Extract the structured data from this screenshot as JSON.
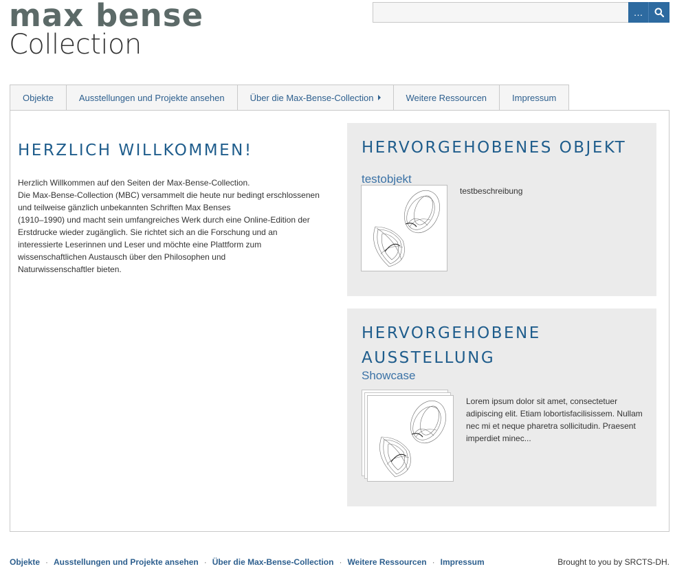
{
  "header": {
    "logo_line1": "max bense",
    "logo_line2": "Collection",
    "search": {
      "value": "",
      "placeholder": "",
      "advanced_label": "…"
    }
  },
  "nav": {
    "items": [
      {
        "label": "Objekte"
      },
      {
        "label": "Ausstellungen und Projekte ansehen"
      },
      {
        "label": "Über die Max-Bense-Collection"
      },
      {
        "label": "Weitere Ressourcen"
      },
      {
        "label": "Impressum"
      }
    ]
  },
  "welcome": {
    "title": "HERZLICH WILLKOMMEN!",
    "lines": [
      "Herzlich Willkommen auf den Seiten der Max-Bense-Collection.",
      "Die Max-Bense-Collection (MBC) versammelt die heute nur bedingt erschlossenen",
      "und teilweise gänzlich unbekannten Schriften Max Benses",
      "(1910–1990) und macht sein umfangreiches Werk durch eine Online-Edition der",
      "Erstdrucke wieder zugänglich. Sie richtet sich an die Forschung und an",
      "interessierte Leserinnen und Leser und möchte eine Plattform zum",
      "wissenschaftlichen Austausch über den Philosophen und",
      "Naturwissenschaftler bieten."
    ]
  },
  "featured_object": {
    "heading": "HERVORGEHOBENES OBJEKT",
    "title": "testobjekt",
    "description": "testbeschreibung"
  },
  "featured_exhibition": {
    "heading": "HERVORGEHOBENE AUSSTELLUNG",
    "title": "Showcase",
    "description": "Lorem ipsum dolor sit amet, consectetuer adipiscing elit. Etiam lobortisfacilisissem. Nullam nec mi et neque pharetra sollicitudin. Praesent imperdiet minec..."
  },
  "footer": {
    "links": [
      {
        "label": "Objekte"
      },
      {
        "label": "Ausstellungen und Projekte ansehen"
      },
      {
        "label": "Über die Max-Bense-Collection"
      },
      {
        "label": "Weitere Ressourcen"
      },
      {
        "label": "Impressum"
      }
    ],
    "separator": "·",
    "credit": "Brought to you by SRCTS-DH."
  },
  "colors": {
    "accent": "#2d6aa0",
    "heading": "#1f5d8c",
    "link": "#2d5f8e",
    "panel_bg": "#ebebeb",
    "logo": "#5c6a68"
  },
  "icons": {
    "search": "search-icon",
    "submenu": "caret-right-icon"
  }
}
